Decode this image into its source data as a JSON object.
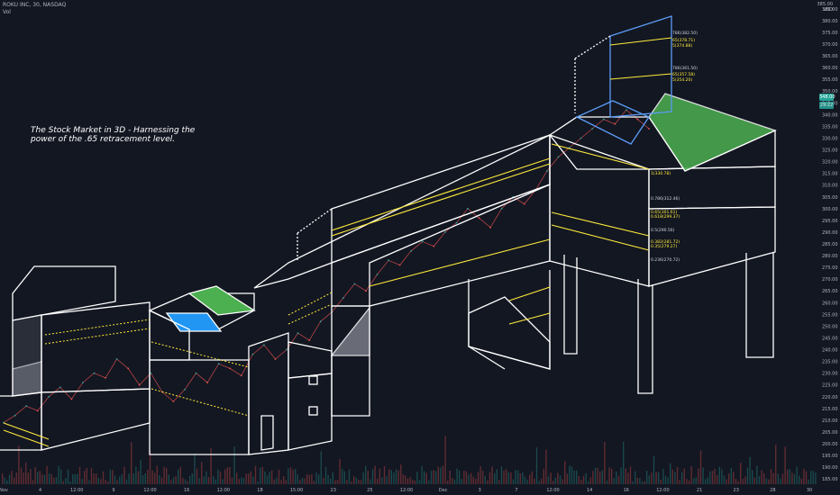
{
  "header": {
    "symbol_line": "ROKU INC, 30, NASDAQ",
    "volume_label": "Vol"
  },
  "annotation": {
    "text": "The Stock Market in 3D - Harnessing the power of the .65 retracement level."
  },
  "price_axis": {
    "currency": "USD",
    "currency_top": "385.00",
    "last_price": "348.00",
    "countdown": "29:22"
  },
  "chart_data": {
    "type": "line",
    "title": "",
    "xlabel": "",
    "ylabel": "",
    "ylim": [
      182,
      388
    ],
    "grid": false,
    "y_ticks": [
      385,
      380,
      375,
      370,
      365,
      360,
      355,
      350,
      345,
      340,
      335,
      330,
      325,
      320,
      315,
      310,
      305,
      300,
      295,
      290,
      285,
      280,
      275,
      270,
      265,
      260,
      255,
      250,
      245,
      240,
      235,
      230,
      225,
      220,
      215,
      210,
      205,
      200,
      195,
      190,
      185
    ],
    "x_ticks": [
      "Nov",
      "4",
      "12:00",
      "9",
      "12:00",
      "16",
      "12:00",
      "18",
      "15:00",
      "23",
      "25",
      "12:00",
      "Dec",
      "3",
      "7",
      "12:00",
      "14",
      "16",
      "12:00",
      "21",
      "23",
      "28",
      "30"
    ],
    "series": [
      {
        "values": [
          209,
          212,
          216,
          214,
          220,
          224,
          219,
          226,
          230,
          228,
          236,
          232,
          225,
          230,
          222,
          218,
          223,
          230,
          226,
          234,
          232,
          229,
          238,
          242,
          236,
          240,
          247,
          244,
          252,
          256,
          262,
          268,
          265,
          272,
          278,
          276,
          282,
          286,
          284,
          290,
          294,
          300,
          296,
          292,
          300,
          305,
          302,
          308,
          316,
          322,
          326,
          330,
          334,
          338,
          336,
          342,
          338,
          334
        ]
      }
    ],
    "fib_labels_upper": [
      "786(382.50)",
      "65(378.71)",
      "5(374.88)",
      "786(361.50)",
      "65(357.58)",
      "5(354.20)"
    ],
    "fib_labels_right": [
      "1(330.78)",
      "0.786(312.46)",
      "0.65(301.61)",
      "0.618(299.37)",
      "0.5(290.56)",
      "0.382(281.72)",
      "0.35(279.27)",
      "0.236(270.72)"
    ]
  }
}
